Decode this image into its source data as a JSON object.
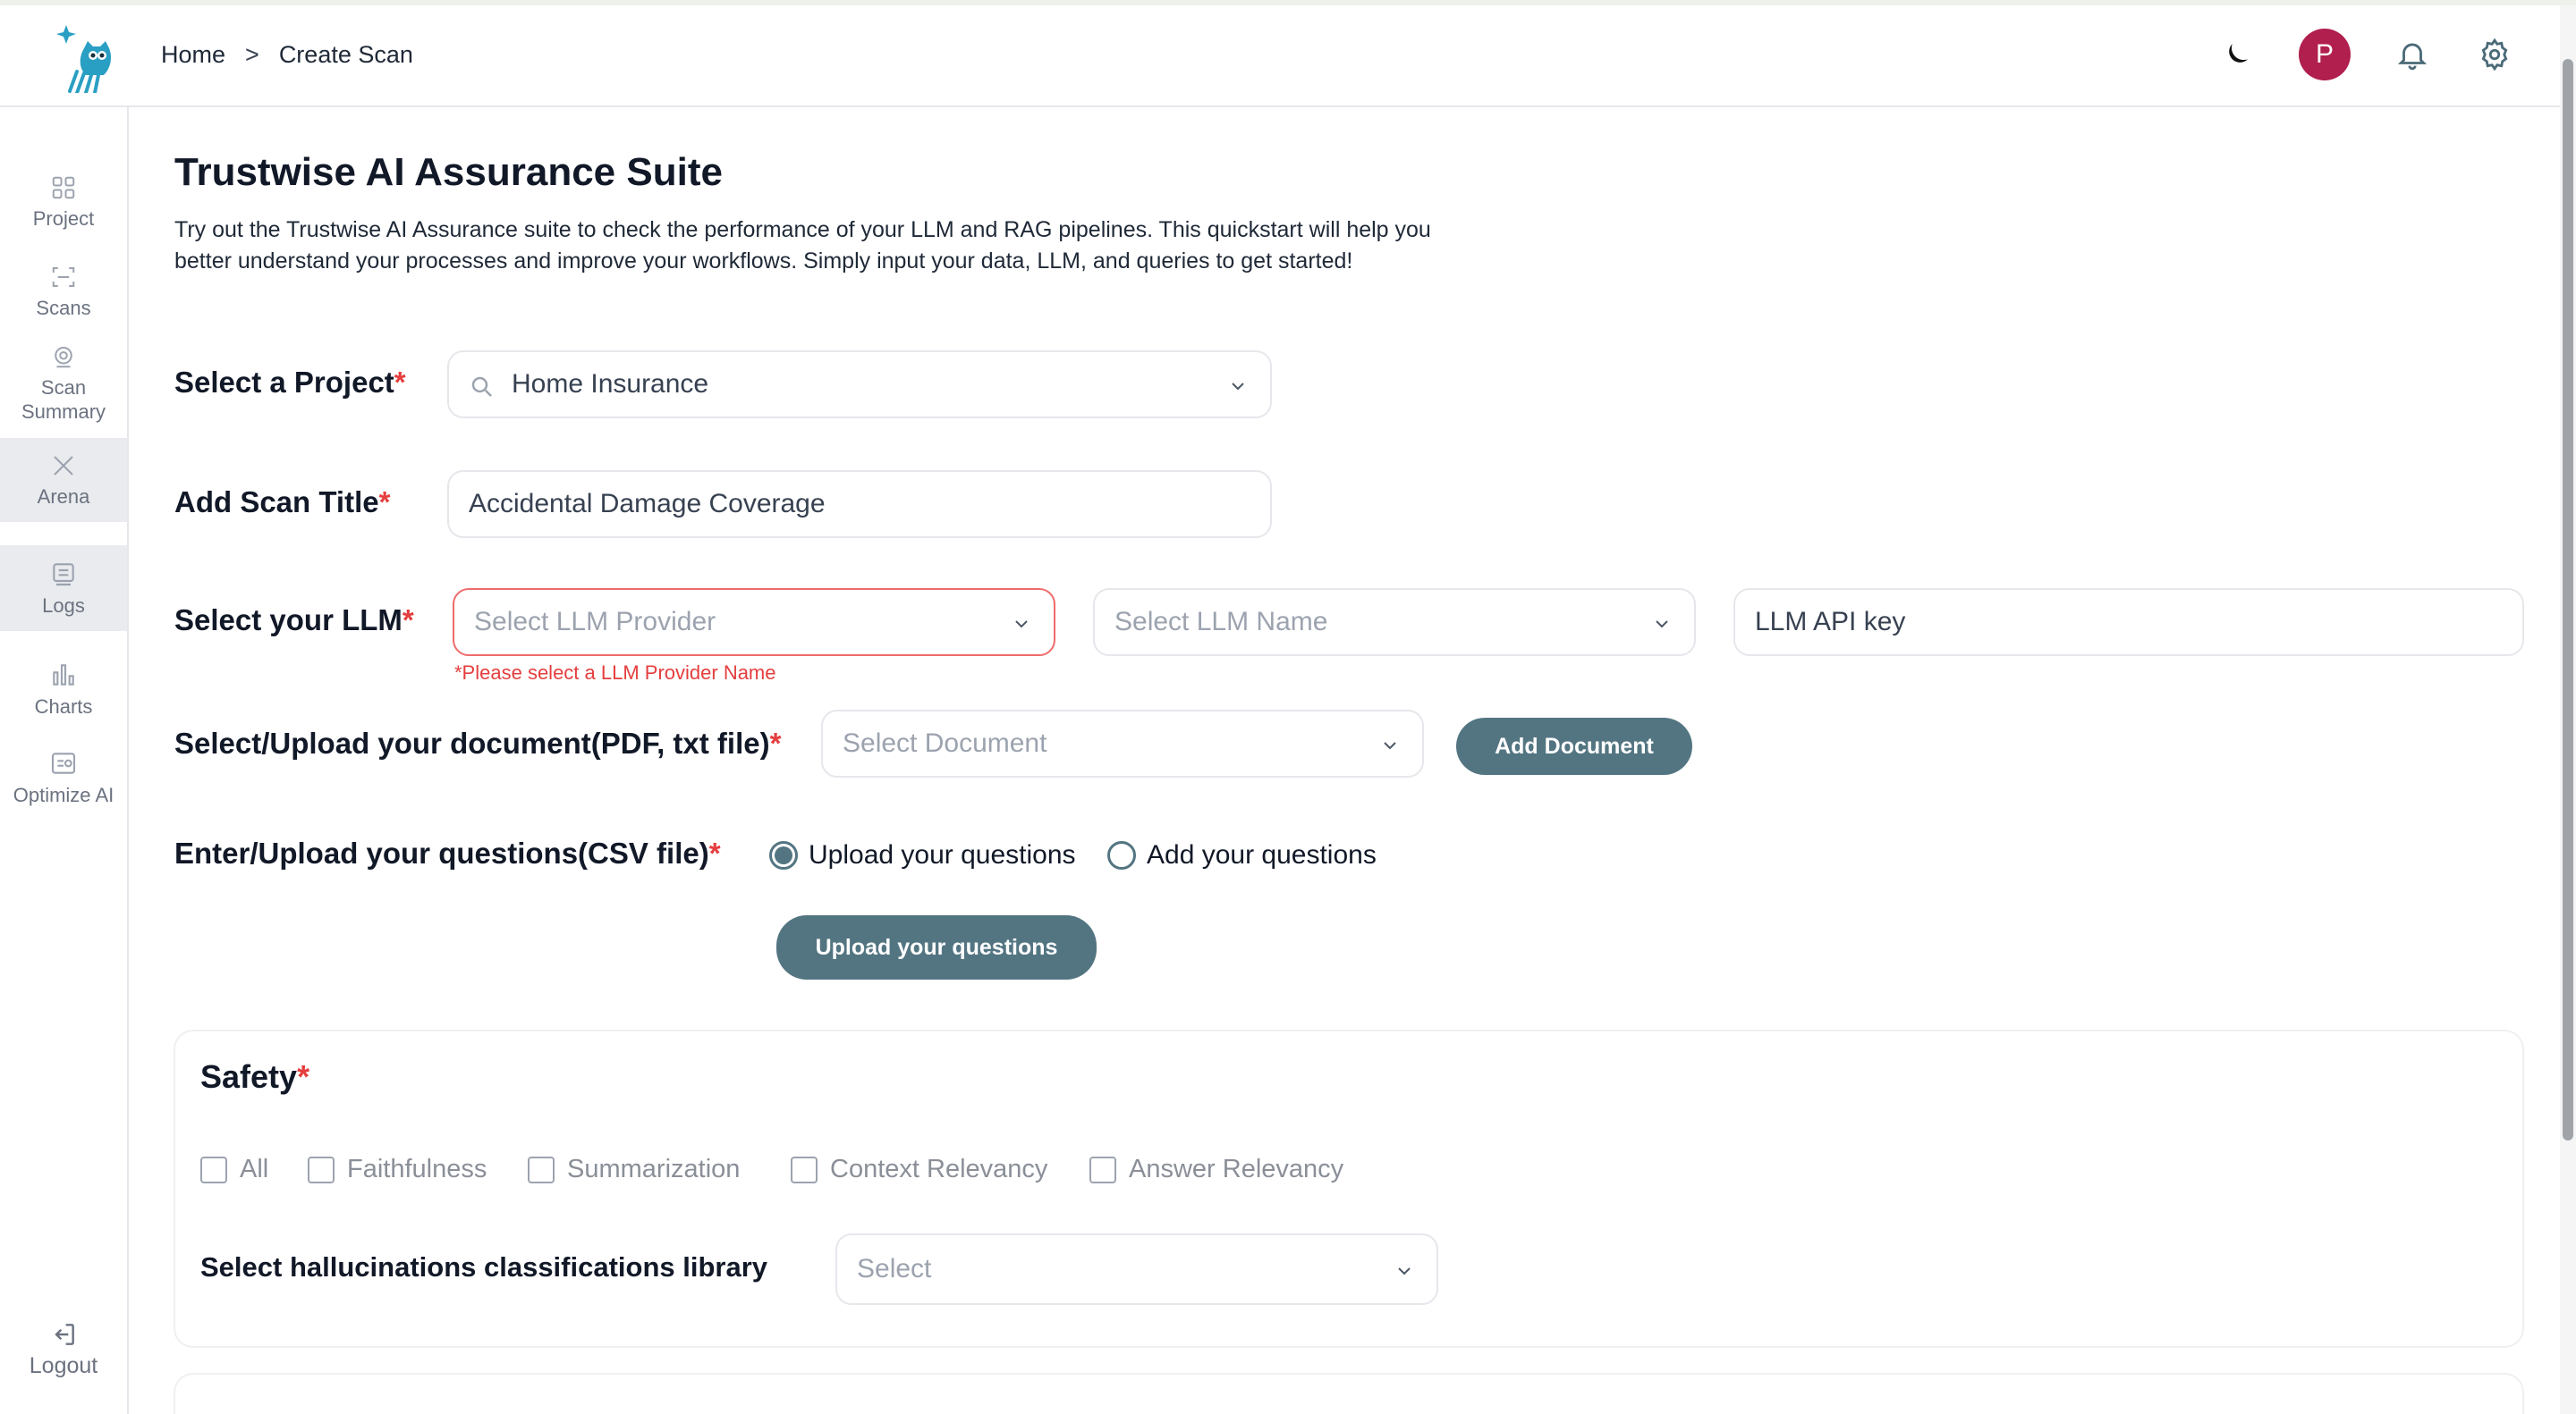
{
  "breadcrumb": {
    "home": "Home",
    "separator": ">",
    "current": "Create Scan"
  },
  "header": {
    "avatar_initial": "P",
    "icons": [
      "moon-icon",
      "bell-icon",
      "gear-icon"
    ]
  },
  "sidebar": {
    "items": [
      {
        "label": "Project",
        "icon": "grid-icon"
      },
      {
        "label": "Scans",
        "icon": "scan-icon"
      },
      {
        "label": "Scan Summary",
        "icon": "summary-icon"
      },
      {
        "label": "Arena",
        "icon": "swords-icon"
      },
      {
        "label": "Logs",
        "icon": "logs-icon"
      },
      {
        "label": "Charts",
        "icon": "bar-chart-icon"
      },
      {
        "label": "Optimize AI",
        "icon": "optimize-icon"
      }
    ],
    "logout": "Logout"
  },
  "main": {
    "title": "Trustwise AI Assurance Suite",
    "description": "Try out the Trustwise AI Assurance suite to check the performance of your LLM and RAG pipelines. This quickstart will help you better understand your processes and improve your workflows. Simply input your data, LLM, and queries to get started!",
    "project": {
      "label": "Select a Project",
      "value": "Home Insurance"
    },
    "scan_title": {
      "label": "Add Scan Title",
      "value": "Accidental Damage Coverage"
    },
    "llm": {
      "label": "Select your LLM",
      "provider_placeholder": "Select LLM Provider",
      "name_placeholder": "Select LLM Name",
      "api_key_placeholder": "LLM API key",
      "error": "*Please select a LLM Provider Name"
    },
    "document": {
      "label": "Select/Upload your document(PDF, txt file)",
      "placeholder": "Select Document",
      "add_button": "Add Document"
    },
    "questions": {
      "label": "Enter/Upload your questions(CSV file)",
      "options": [
        "Upload your questions",
        "Add your questions"
      ],
      "selected": "Upload your questions",
      "upload_button": "Upload your questions"
    },
    "safety": {
      "title": "Safety",
      "checkboxes": [
        "All",
        "Faithfulness",
        "Summarization",
        "Context Relevancy",
        "Answer Relevancy"
      ],
      "library_label": "Select hallucinations classifications library",
      "library_placeholder": "Select"
    },
    "required_mark": "*"
  },
  "colors": {
    "primary_button": "#537582",
    "error": "#e53e3e",
    "avatar": "#b01f4e"
  }
}
